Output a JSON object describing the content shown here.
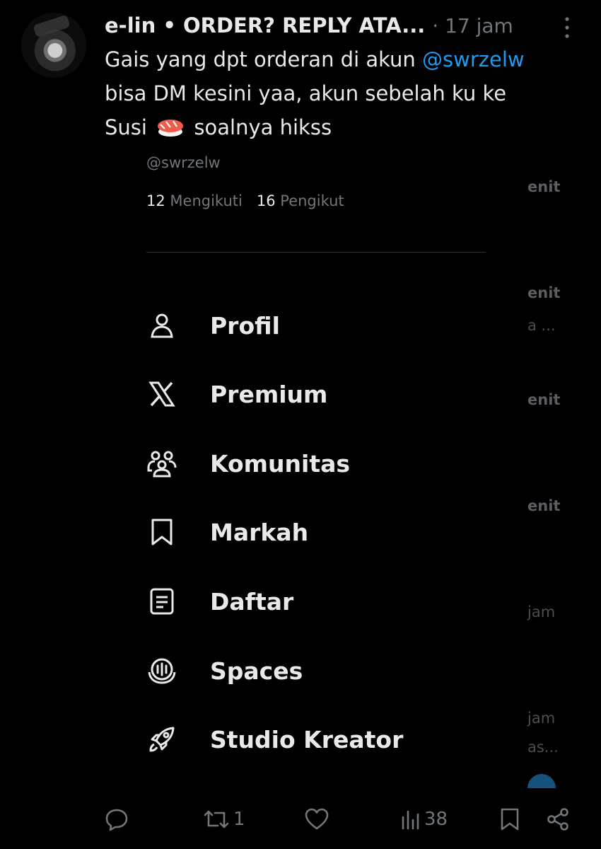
{
  "tweet": {
    "author_name": "e-lin • ORDER? REPLY ATA...",
    "time": "· 17 jam",
    "text_1": "Gais yang dpt orderan di akun ",
    "mention": "@swrzelw",
    "text_2": "bisa DM kesini yaa, akun sebelah ku ke",
    "text_3a": "Susi ",
    "text_3b": " soalnya hikss"
  },
  "account_card": {
    "handle": "@swrzelw",
    "following_count": "12",
    "following_label": "Mengikuti",
    "followers_count": "16",
    "followers_label": "Pengikut"
  },
  "menu": {
    "items": [
      {
        "label": "Profil",
        "icon": "person-icon"
      },
      {
        "label": "Premium",
        "icon": "x-logo-icon"
      },
      {
        "label": "Komunitas",
        "icon": "communities-icon"
      },
      {
        "label": "Markah",
        "icon": "bookmark-icon"
      },
      {
        "label": "Daftar",
        "icon": "list-icon"
      },
      {
        "label": "Spaces",
        "icon": "spaces-icon"
      },
      {
        "label": "Studio Kreator",
        "icon": "rocket-icon"
      }
    ]
  },
  "background_list": {
    "items": [
      "enit",
      "enit",
      "a ...",
      "enit",
      "enit",
      "jam",
      "jam",
      "as..."
    ]
  },
  "actions": {
    "reply_icon": "reply-icon",
    "retweet_count": "1",
    "like_icon": "heart-icon",
    "views_count": "38",
    "bookmark_icon": "bookmark-icon",
    "share_icon": "share-icon"
  },
  "colors": {
    "background": "#000000",
    "text": "#e7e9ea",
    "secondary": "#71767b",
    "accent": "#1d9bf0"
  }
}
